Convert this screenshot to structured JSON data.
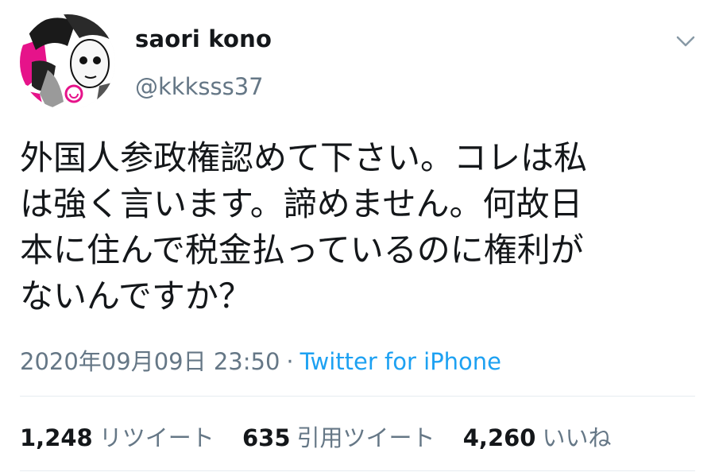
{
  "user": {
    "display_name": "saori kono",
    "handle": "@kkksss37",
    "avatar_icon": "manga-avatar-icon",
    "menu_icon": "chevron-down-icon"
  },
  "tweet": {
    "text": "外国人参政権認めて下さい。コレは私\nは強く言います。諦めません。何故日\n本に住んで税金払っているのに権利が\nないんですか？",
    "timestamp": "2020年09月09日 23:50",
    "separator": "·",
    "source": "Twitter for iPhone"
  },
  "stats": {
    "retweets": {
      "count": "1,248",
      "label": "リツイート"
    },
    "quotes": {
      "count": "635",
      "label": "引用ツイート"
    },
    "likes": {
      "count": "4,260",
      "label": "いいね"
    }
  },
  "colors": {
    "text": "#14171a",
    "secondary": "#657786",
    "link": "#1da1f2",
    "divider": "#e6ecf0"
  }
}
